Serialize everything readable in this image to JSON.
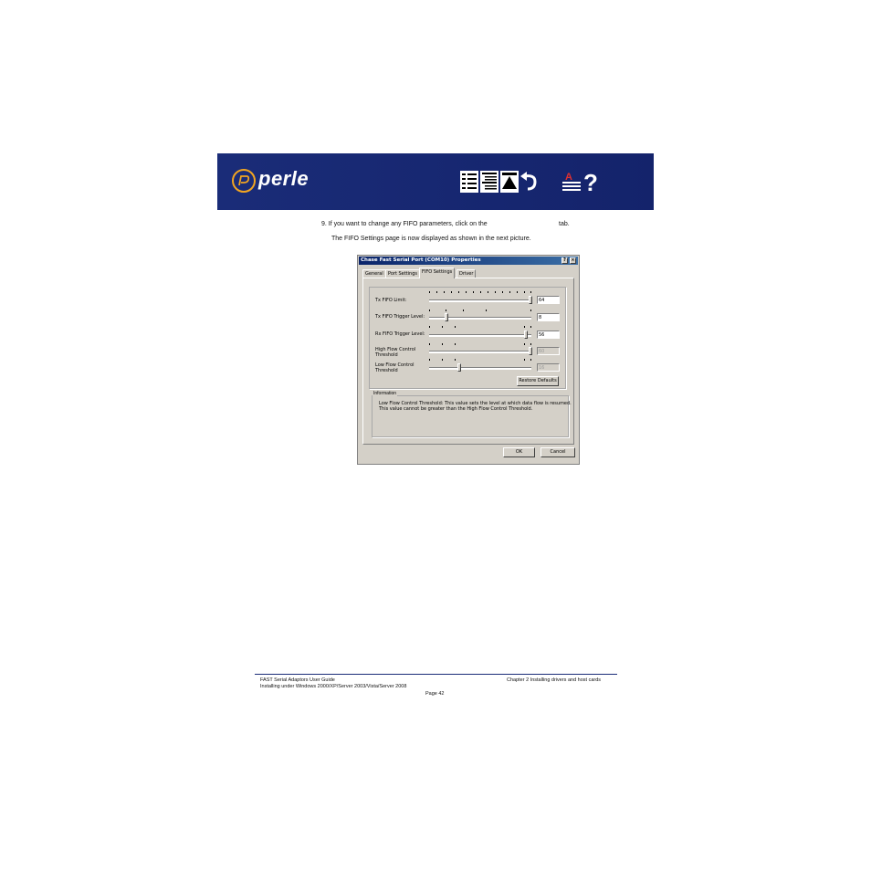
{
  "banner": {
    "brand": "perle",
    "brand_color": "#f2a521",
    "background": "#16266f",
    "icons": [
      "contents-icon",
      "index-icon",
      "top-icon",
      "back-icon",
      "glossary-icon",
      "help-icon"
    ]
  },
  "body": {
    "step_text": "9.  If you want to change any FIFO parameters, click on the",
    "step_tail": "tab.",
    "sub_text": "The FIFO Settings page is now displayed as shown in the next picture."
  },
  "dialog": {
    "title": "Chase Fast Serial Port (COM10) Properties",
    "help_btn": "?",
    "close_btn": "×",
    "tabs": [
      {
        "label": "General",
        "active": false
      },
      {
        "label": "Port Settings",
        "active": false
      },
      {
        "label": "FIFO Settings",
        "active": true
      },
      {
        "label": "Driver",
        "active": false
      }
    ],
    "sliders": [
      {
        "label": "Tx FIFO Limit:",
        "value": "64",
        "level": 1.0,
        "enabled": true
      },
      {
        "label": "Tx FIFO Trigger Level:",
        "value": "8",
        "level": 0.15,
        "enabled": true
      },
      {
        "label": "Rx FIFO Trigger Level:",
        "value": "56",
        "level": 0.95,
        "enabled": true
      },
      {
        "label_line1": "High Flow Control",
        "label_line2": "Threshold",
        "value": "60",
        "level": 1.0,
        "enabled": false
      },
      {
        "label_line1": "Low Flow Control",
        "label_line2": "Threshold",
        "value": "16",
        "level": 0.28,
        "enabled": false
      }
    ],
    "restore_defaults": "Restore Defaults",
    "information_label": "Information",
    "information_line1": "Low Flow Control Threshold: This value sets the level at which data flow is resumed.",
    "information_line2": "This value cannot be greater than the High Flow Control Threshold.",
    "ok": "OK",
    "cancel": "Cancel"
  },
  "footer": {
    "left_line1": "FAST Serial Adaptors User Guide",
    "left_line2": "Installing under Windows 2000/XP/Server 2003/Vista/Server 2008",
    "right": "Chapter 2 Installing drivers and host cards",
    "page": "Page 42"
  }
}
